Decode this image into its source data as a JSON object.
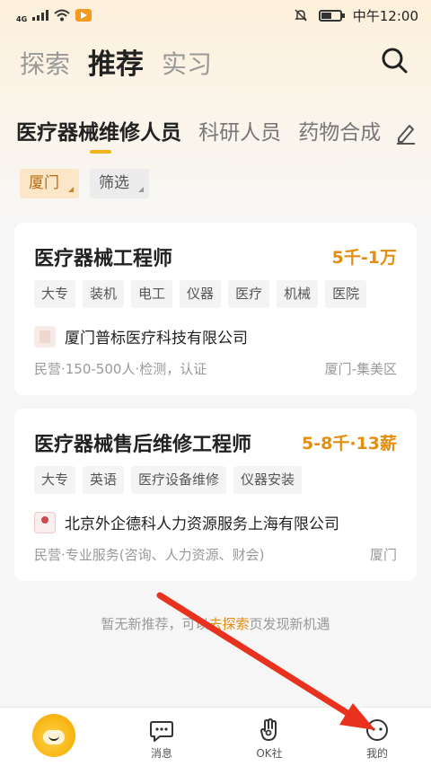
{
  "status_bar": {
    "network": "4G",
    "time": "中午12:00"
  },
  "header": {
    "tabs": [
      {
        "label": "探索"
      },
      {
        "label": "推荐"
      },
      {
        "label": "实习"
      }
    ]
  },
  "categories": [
    {
      "label": "医疗器械维修人员"
    },
    {
      "label": "科研人员"
    },
    {
      "label": "药物合成"
    }
  ],
  "filters": {
    "city": "厦门",
    "filter": "筛选"
  },
  "jobs": [
    {
      "title": "医疗器械工程师",
      "salary": "5千-1万",
      "tags": [
        "大专",
        "装机",
        "电工",
        "仪器",
        "医疗",
        "机械",
        "医院"
      ],
      "company": "厦门普标医疗科技有限公司",
      "meta": "民营·150-500人·检测，认证",
      "location": "厦门-集美区"
    },
    {
      "title": "医疗器械售后维修工程师",
      "salary": "5-8千·13薪",
      "tags": [
        "大专",
        "英语",
        "医疗设备维修",
        "仪器安装"
      ],
      "company": "北京外企德科人力资源服务上海有限公司",
      "meta": "民营·专业服务(咨询、人力资源、财会)",
      "location": "厦门"
    }
  ],
  "no_more": {
    "prefix": "暂无新推荐，可以",
    "link": "去探索",
    "suffix": "页发现新机遇"
  },
  "bottom_nav": {
    "items": [
      {
        "label": "",
        "icon": "home-logo-icon"
      },
      {
        "label": "消息",
        "icon": "message-icon"
      },
      {
        "label": "OK社",
        "icon": "ok-hand-icon"
      },
      {
        "label": "我的",
        "icon": "profile-icon"
      }
    ]
  },
  "colors": {
    "accent": "#e38d11",
    "annotation_arrow": "#e8321e"
  }
}
